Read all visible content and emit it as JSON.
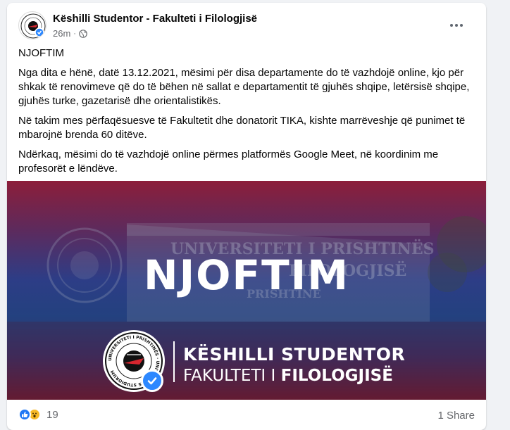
{
  "post": {
    "author": "Këshilli Studentor - Fakulteti i Filologjisë",
    "time": "26m",
    "dot": "·",
    "paragraphs": [
      "NJOFTIM",
      "Nga dita e hënë, datë 13.12.2021, mësimi për disa departamente do të vazhdojë online, kjo për shkak të renovimeve që do të bëhen në sallat e departamentit të gjuhës shqipe, letërsisë shqipe, gjuhës turke, gazetarisë dhe orientalistikës.",
      "Në takim mes përfaqësuesve të Fakultetit dhe donatorit TIKA, kishte marrëveshje që punimet të mbarojnë brenda 60 ditëve.",
      "Ndërkaq, mësimi do të vazhdojë online përmes platformës Google Meet, në koordinim me profesorët e lëndëve."
    ]
  },
  "image": {
    "title": "NJOFTIM",
    "org_line1": "KËSHILLI STUDENTOR",
    "org_line2_regular": "FAKULTETI I ",
    "org_line2_bold": "FILOLOGJISË",
    "building_sign_line1": "UNIVERSITETI I PRISHTINËS",
    "building_sign_line2": "FILOLOGJISË",
    "building_sign_line3": "PRISHTINË",
    "seal_text": "UNIVERSITETI I PRISHTINËS · UNIVERSITAS STUDIORUM"
  },
  "footer": {
    "reaction_count": "19",
    "shares": "1 Share"
  },
  "icons": {
    "privacy": "globe-icon",
    "more": "more-options-icon",
    "like": "like-reaction-icon",
    "wow": "wow-reaction-icon",
    "verified": "verified-check-icon"
  },
  "colors": {
    "brand_blue": "#2078f4",
    "crimson": "#8c1e3a",
    "navy": "#23417f",
    "wow_yellow": "#f7b928"
  }
}
